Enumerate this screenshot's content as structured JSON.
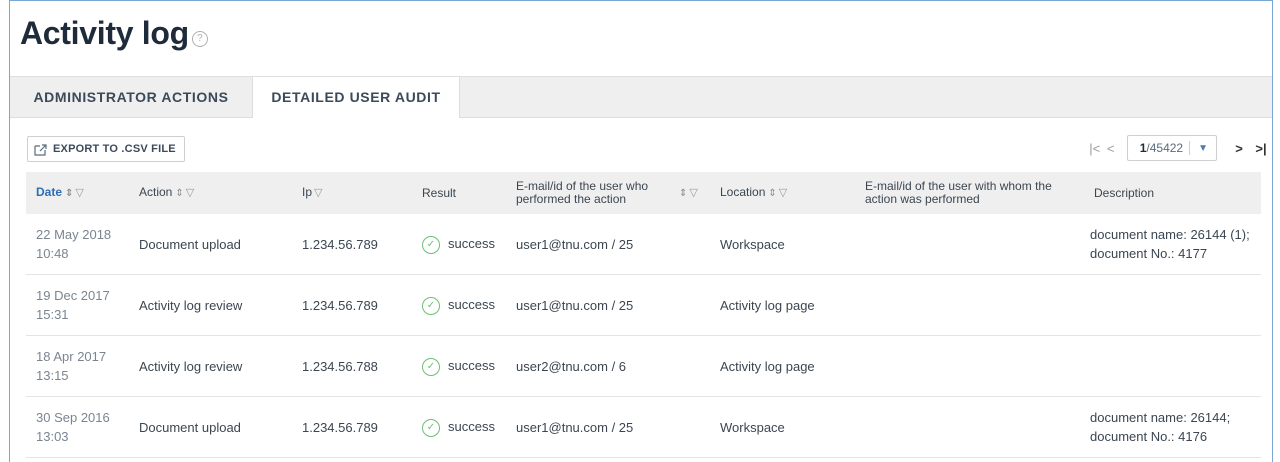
{
  "page": {
    "title": "Activity log",
    "help_symbol": "?"
  },
  "tabs": [
    {
      "label": "ADMINISTRATOR ACTIONS",
      "active": false
    },
    {
      "label": "DETAILED USER AUDIT",
      "active": true
    }
  ],
  "toolbar": {
    "export_label": "EXPORT TO .CSV FILE"
  },
  "pagination": {
    "current": "1",
    "total": "/45422",
    "first": "|<",
    "prev": "<",
    "next": ">",
    "last": ">|"
  },
  "table": {
    "columns": [
      {
        "label": "Date",
        "sortable": true,
        "filterable": true
      },
      {
        "label": "Action",
        "sortable": true,
        "filterable": true
      },
      {
        "label": "Ip",
        "sortable": false,
        "filterable": true
      },
      {
        "label": "Result",
        "sortable": false,
        "filterable": false
      },
      {
        "label": "E-mail/id of the user who performed the action",
        "sortable": true,
        "filterable": true
      },
      {
        "label": "Location",
        "sortable": true,
        "filterable": true
      },
      {
        "label": "E-mail/id of the user with whom the action was performed",
        "sortable": false,
        "filterable": false
      },
      {
        "label": "Description",
        "sortable": false,
        "filterable": false
      }
    ],
    "rows": [
      {
        "date": "22 May 2018",
        "time": "10:48",
        "action": "Document upload",
        "ip": "1.234.56.789",
        "result": "success",
        "user": "user1@tnu.com / 25",
        "location": "Workspace",
        "target": "",
        "description": "document name: 26144 (1); document No.: 4177"
      },
      {
        "date": "19 Dec 2017",
        "time": "15:31",
        "action": "Activity log review",
        "ip": "1.234.56.789",
        "result": "success",
        "user": "user1@tnu.com / 25",
        "location": "Activity log page",
        "target": "",
        "description": ""
      },
      {
        "date": "18 Apr 2017",
        "time": "13:15",
        "action": "Activity log review",
        "ip": "1.234.56.788",
        "result": "success",
        "user": "user2@tnu.com / 6",
        "location": "Activity log page",
        "target": "",
        "description": ""
      },
      {
        "date": "30 Sep 2016",
        "time": "13:03",
        "action": "Document upload",
        "ip": "1.234.56.789",
        "result": "success",
        "user": "user1@tnu.com / 25",
        "location": "Workspace",
        "target": "",
        "description": "document name: 26144; document No.: 4176"
      }
    ]
  },
  "colors": {
    "accent": "#2d6db5",
    "success": "#6fbf73",
    "frame": "#7aa7d6"
  }
}
